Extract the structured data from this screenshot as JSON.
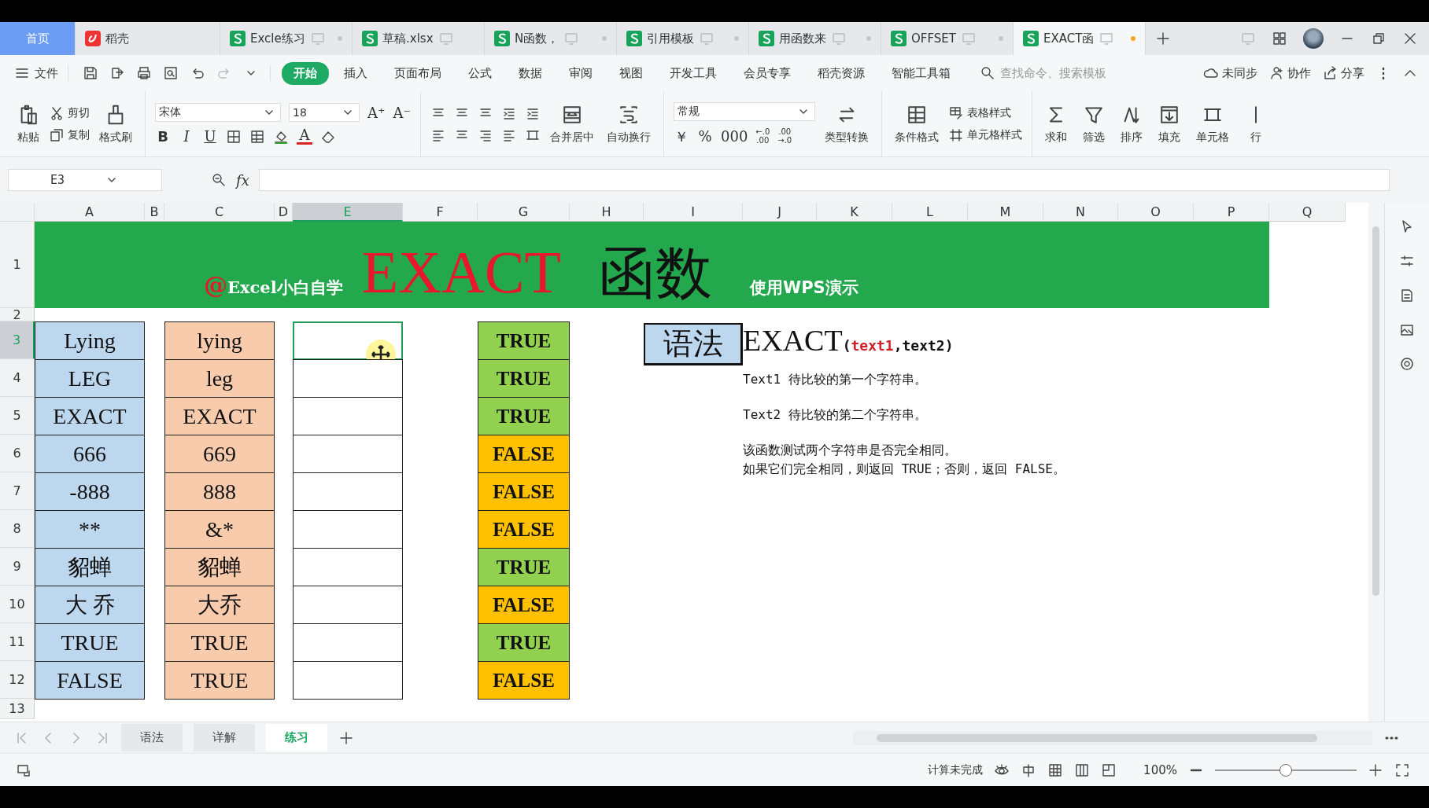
{
  "tabs": [
    {
      "label": "首页",
      "kind": "home",
      "selected": false,
      "unsaved": false
    },
    {
      "label": "稻壳",
      "kind": "docer",
      "selected": false,
      "unsaved": false
    },
    {
      "label": "Excle练习",
      "kind": "sheet",
      "selected": false,
      "unsaved": true
    },
    {
      "label": "草稿.xlsx",
      "kind": "sheet",
      "selected": false,
      "unsaved": false
    },
    {
      "label": "N函数，",
      "kind": "sheet",
      "selected": false,
      "unsaved": true
    },
    {
      "label": "引用模板",
      "kind": "sheet",
      "selected": false,
      "unsaved": true
    },
    {
      "label": "用函数来",
      "kind": "sheet",
      "selected": false,
      "unsaved": true
    },
    {
      "label": "OFFSET",
      "kind": "sheet",
      "selected": false,
      "unsaved": true
    },
    {
      "label": "EXACT函",
      "kind": "sheet",
      "selected": true,
      "unsaved": true
    }
  ],
  "menu": {
    "file": "文件",
    "ribbon_tabs": [
      {
        "label": "开始",
        "selected": true
      },
      {
        "label": "插入",
        "selected": false
      },
      {
        "label": "页面布局",
        "selected": false
      },
      {
        "label": "公式",
        "selected": false
      },
      {
        "label": "数据",
        "selected": false
      },
      {
        "label": "审阅",
        "selected": false
      },
      {
        "label": "视图",
        "selected": false
      },
      {
        "label": "开发工具",
        "selected": false
      },
      {
        "label": "会员专享",
        "selected": false
      },
      {
        "label": "稻壳资源",
        "selected": false
      },
      {
        "label": "智能工具箱",
        "selected": false
      }
    ],
    "search": {
      "placeholder": "查找命令、搜索模板"
    },
    "actions": [
      "未同步",
      "协作",
      "分享"
    ]
  },
  "ribbon": {
    "paste": "粘贴",
    "cut": "剪切",
    "copy": "复制",
    "format_painter": "格式刷",
    "font": "宋体",
    "font_size": "18",
    "size_marks": [
      "A⁺",
      "A⁻"
    ],
    "format_marks": [
      "B",
      "I",
      "U"
    ],
    "font_color_mark": "A",
    "merge": "合并居中",
    "wrap": "自动换行",
    "number_format": "常规",
    "number_marks": [
      "￥",
      "%",
      "000"
    ],
    "decimal_marks": [
      {
        "top": "←.0",
        "bottom": ".00"
      },
      {
        "top": ".00",
        "bottom": "→.0"
      }
    ],
    "convert": "类型转换",
    "conditional": "条件格式",
    "table_style": "表格样式",
    "cell_style": "单元格样式",
    "tools": [
      "求和",
      "筛选",
      "排序",
      "填充",
      "单元格",
      "行"
    ]
  },
  "formula_bar": {
    "name_box": "E3",
    "fx": "fx"
  },
  "columns": [
    {
      "label": "A",
      "selected": false
    },
    {
      "label": "B",
      "selected": false
    },
    {
      "label": "C",
      "selected": false
    },
    {
      "label": "D",
      "selected": false
    },
    {
      "label": "E",
      "selected": true
    },
    {
      "label": "F",
      "selected": false
    },
    {
      "label": "G",
      "selected": false
    },
    {
      "label": "H",
      "selected": false
    },
    {
      "label": "I",
      "selected": false
    },
    {
      "label": "J",
      "selected": false
    },
    {
      "label": "K",
      "selected": false
    },
    {
      "label": "L",
      "selected": false
    },
    {
      "label": "M",
      "selected": false
    },
    {
      "label": "N",
      "selected": false
    },
    {
      "label": "O",
      "selected": false
    },
    {
      "label": "P",
      "selected": false
    },
    {
      "label": "Q",
      "selected": false
    }
  ],
  "row_numbers": [
    {
      "label": "1",
      "selected": false
    },
    {
      "label": "2",
      "selected": false
    },
    {
      "label": "3",
      "selected": true
    },
    {
      "label": "4",
      "selected": false
    },
    {
      "label": "5",
      "selected": false
    },
    {
      "label": "6",
      "selected": false
    },
    {
      "label": "7",
      "selected": false
    },
    {
      "label": "8",
      "selected": false
    },
    {
      "label": "9",
      "selected": false
    },
    {
      "label": "10",
      "selected": false
    },
    {
      "label": "11",
      "selected": false
    },
    {
      "label": "12",
      "selected": false
    },
    {
      "label": "13",
      "selected": false
    }
  ],
  "banner": {
    "at_mark": "@",
    "handle": "Excel小白自学",
    "title": "EXACT",
    "title_cn": "函数",
    "note": "使用WPS演示"
  },
  "data_rows": [
    {
      "text1": "Lying",
      "text2": "lying",
      "result": "TRUE",
      "color": "#92d050"
    },
    {
      "text1": "LEG",
      "text2": "leg",
      "result": "TRUE",
      "color": "#92d050"
    },
    {
      "text1": "EXACT",
      "text2": "EXACT",
      "result": "TRUE",
      "color": "#92d050"
    },
    {
      "text1": "666",
      "text2": "669",
      "result": "FALSE",
      "color": "#ffc000"
    },
    {
      "text1": "-888",
      "text2": "888",
      "result": "FALSE",
      "color": "#ffc000"
    },
    {
      "text1": "**",
      "text2": "&*",
      "result": "FALSE",
      "color": "#ffc000"
    },
    {
      "text1": "貂蝉",
      "text2": "貂蝉",
      "result": "TRUE",
      "color": "#92d050"
    },
    {
      "text1": "大 乔",
      "text2": "大乔",
      "result": "FALSE",
      "color": "#ffc000"
    },
    {
      "text1": "TRUE",
      "text2": "TRUE",
      "result": "TRUE",
      "color": "#92d050"
    },
    {
      "text1": "FALSE",
      "text2": "TRUE",
      "result": "FALSE",
      "color": "#ffc000"
    }
  ],
  "syntax": {
    "label": "语法",
    "function": "EXACT",
    "args": [
      {
        "text": "(",
        "highlight": false
      },
      {
        "text": "text1",
        "highlight": true
      },
      {
        "text": ",text2)",
        "highlight": false
      }
    ],
    "descriptions": [
      {
        "lines": [
          "Text1 待比较的第一个字符串。"
        ]
      },
      {
        "lines": [
          "Text2 待比较的第二个字符串。"
        ]
      },
      {
        "lines": [
          "该函数测试两个字符串是否完全相同。",
          "如果它们完全相同，则返回 TRUE；否则，返回 FALSE。"
        ]
      }
    ]
  },
  "sheet_tabs": [
    {
      "label": "语法",
      "selected": false
    },
    {
      "label": "详解",
      "selected": false
    },
    {
      "label": "练习",
      "selected": true
    }
  ],
  "status_bar": {
    "calc_state": "计算未完成",
    "zoom": "100%",
    "zoom_slider": {
      "level": 0.5
    }
  }
}
